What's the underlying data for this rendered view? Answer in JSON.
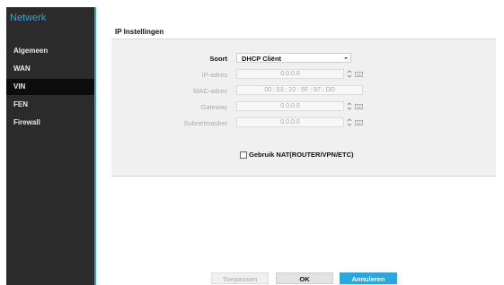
{
  "sidebar": {
    "title": "Netwerk",
    "items": [
      {
        "label": "Algemeen",
        "active": false
      },
      {
        "label": "WAN",
        "active": false
      },
      {
        "label": "VIN",
        "active": true
      },
      {
        "label": "FEN",
        "active": false
      },
      {
        "label": "Firewall",
        "active": false
      }
    ]
  },
  "section": {
    "title": "IP Instellingen"
  },
  "form": {
    "soort": {
      "label": "Soort",
      "value": "DHCP Cliënt"
    },
    "ip": {
      "label": "IP-adres",
      "value": "0.0.0.0"
    },
    "mac": {
      "label": "MAC-adres",
      "value": "00 : 03 : 22 : 5F : 97 : DD"
    },
    "gateway": {
      "label": "Gateway",
      "value": "0.0.0.0"
    },
    "subnet": {
      "label": "Subnetmasker",
      "value": "0.0.0.0"
    }
  },
  "nat_checkbox": {
    "label": "Gebruik NAT(ROUTER/VPN/ETC)",
    "checked": false
  },
  "buttons": {
    "apply": "Toepassen",
    "ok": "OK",
    "cancel": "Annuleren"
  },
  "colors": {
    "accent": "#2aa7de",
    "sidebar_bg": "#2b2b2b",
    "active_item_bg": "#0c0c0c",
    "panel_bg": "#f0f0f0"
  },
  "icons": {
    "select_arrow": "chevron-down-icon",
    "spinner": "spinner-icon",
    "keyboard": "keyboard-icon"
  }
}
